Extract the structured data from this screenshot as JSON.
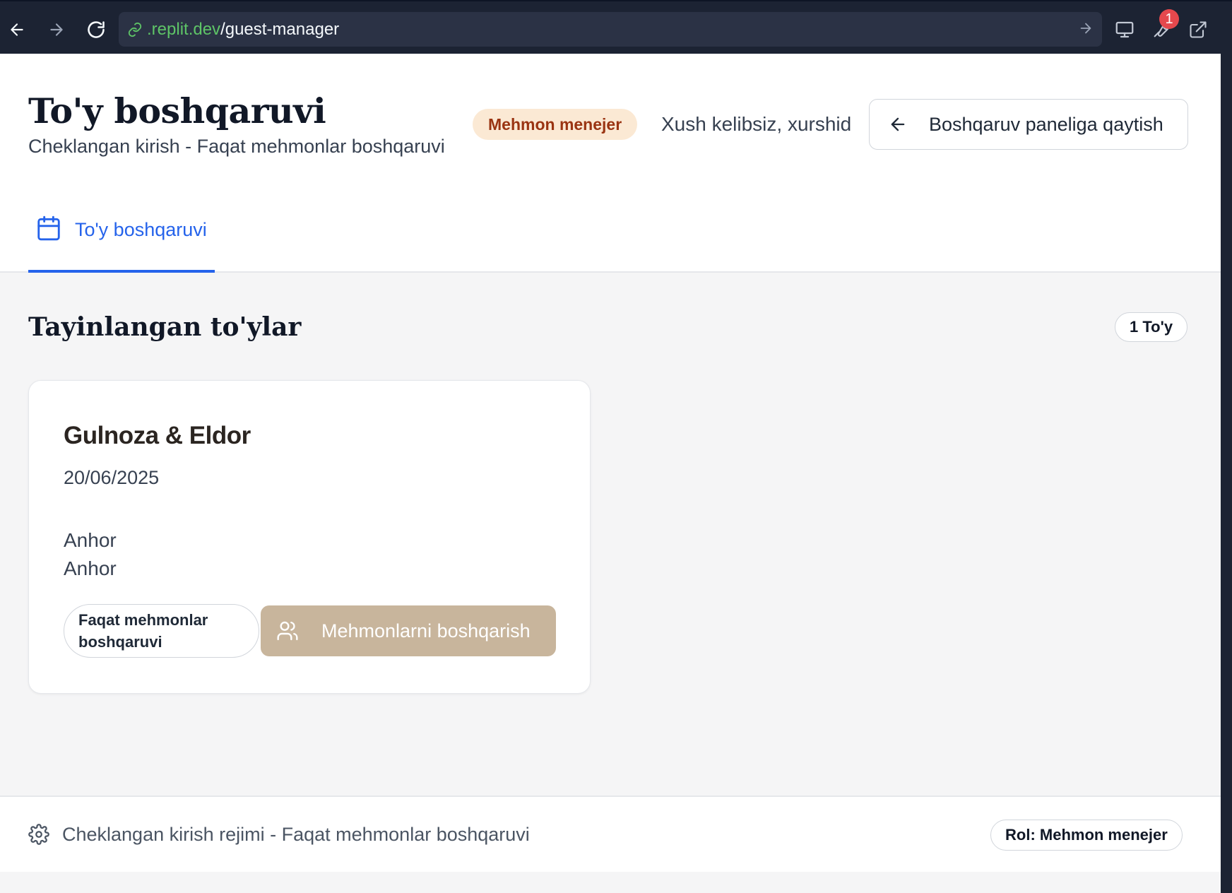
{
  "browser": {
    "url_host": ".replit.dev",
    "url_path": "/guest-manager",
    "notification_count": "1"
  },
  "header": {
    "title": "To'y boshqaruvi",
    "subtitle": "Cheklangan kirish - Faqat mehmonlar boshqaruvi",
    "role_badge": "Mehmon menejer",
    "welcome": "Xush kelibsiz, xurshid",
    "back_button": "Boshqaruv paneliga qaytish"
  },
  "tabs": [
    {
      "label": "To'y boshqaruvi",
      "active": true,
      "icon": "calendar-icon"
    }
  ],
  "section": {
    "title": "Tayinlangan to'ylar",
    "count_badge": "1 To'y"
  },
  "weddings": [
    {
      "couple": "Gulnoza & Eldor",
      "date": "20/06/2025",
      "venue_line1": "Anhor",
      "venue_line2": "Anhor",
      "access_badge": "Faqat mehmonlar boshqaruvi",
      "manage_button": "Mehmonlarni boshqarish"
    }
  ],
  "footer": {
    "text": "Cheklangan kirish rejimi - Faqat mehmonlar boshqaruvi",
    "role": "Rol: Mehmon menejer"
  },
  "colors": {
    "accent": "#2563eb",
    "role_badge_bg": "#fbe9d4",
    "role_badge_text": "#9a3412",
    "manage_button_bg": "#c8b59c"
  }
}
